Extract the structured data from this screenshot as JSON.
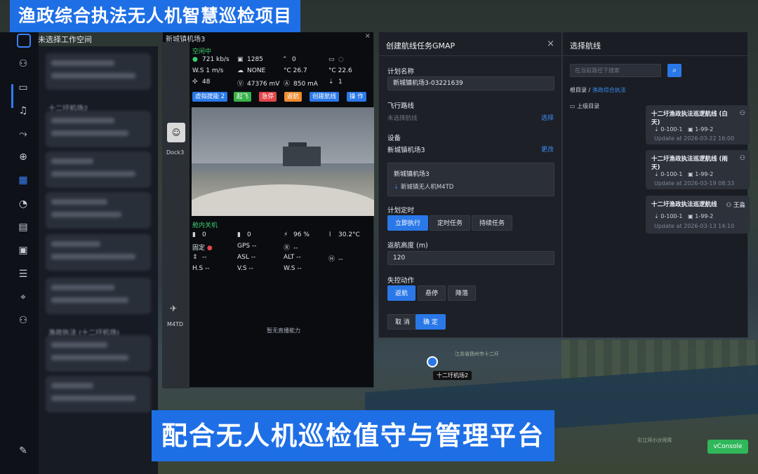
{
  "banner_top": "渔政综合执法无人机智慧巡检项目",
  "banner_bottom": "配合无人机巡检值守与管理平台",
  "workspace": "未选择工作空间",
  "device_list": {
    "labels": [
      "十二圩机场2",
      "渔政执法 (十二圩机场)"
    ]
  },
  "dock": {
    "title": "新城镇机场3",
    "close": "×",
    "dock_label": "Dock3",
    "drone_label": "M4TD",
    "status": "空闲中",
    "stats": {
      "net": "721 kb/s",
      "count": "1285",
      "wind_zero": "0",
      "ws": "W.S  1 m/s",
      "rain": "NONE",
      "temp1": "°C  26.7",
      "temp2": "°C  22.6",
      "n48": "48",
      "voltage": "47376 mV",
      "current": "850 mA",
      "one": "1"
    },
    "buttons": [
      "虚拟提能 2",
      "起飞",
      "急停",
      "返航",
      "创建航线",
      "操 作"
    ],
    "aircraft_status": "舱内关机",
    "aircraft": {
      "sig1": "0",
      "sig2": "0",
      "battery": "96 %",
      "temp": "30.2°C",
      "fix_label": "固定",
      "gps": "GPS  --",
      "r_val": "--",
      "v1": "--",
      "asl": "ASL  --",
      "alt": "ALT  --",
      "h_val": "--",
      "hs": "H.S  --",
      "vs": "V.S  --",
      "ws": "W.S  --"
    },
    "no_live": "暂无直播能力"
  },
  "plan": {
    "title": "创建航线任务GMAP",
    "close": "×",
    "name_label": "计划名称",
    "name_value": "新城镇机场3-03221639",
    "route_label": "飞行路线",
    "route_placeholder": "未选择航线",
    "route_link": "选择",
    "device_label": "设备",
    "device_value": "新城镇机场3",
    "device_link": "更改",
    "device_box_title": "新城镇机场3",
    "device_box_drone": "新城镇无人机M4TD",
    "timer_label": "计划定时",
    "timer_options": [
      "立即执行",
      "定时任务",
      "持续任务"
    ],
    "rth_label": "返航高度 (m)",
    "rth_value": "120",
    "lost_label": "失控动作",
    "lost_options": [
      "返航",
      "悬停",
      "降落"
    ],
    "cancel": "取 消",
    "confirm": "确 定"
  },
  "routes": {
    "title": "选择航线",
    "search_placeholder": "在当前路径下搜索",
    "crumb_root": "根目录",
    "crumb_sep": "/",
    "crumb_current": "渔政综合执法",
    "up_dir": "上级目录",
    "items": [
      {
        "name": "十二圩渔政执法巡逻航线 (白天)",
        "owner": "",
        "meta1": "0-100-1",
        "meta2": "1-99-2",
        "updated": "Update at 2026-03-22 16:00"
      },
      {
        "name": "十二圩渔政执法巡逻航线 (雨天)",
        "owner": "",
        "meta1": "0-100-1",
        "meta2": "1-99-2",
        "updated": "Update at 2026-03-19 08:33"
      },
      {
        "name": "十二圩渔政执法巡逻航线",
        "owner": "王淼",
        "meta1": "0-100-1",
        "meta2": "1-99-2",
        "updated": "Update at 2026-03-13 14:10"
      }
    ]
  },
  "map": {
    "tag": "十二圩机场2",
    "places": [
      "江苏省扬州市十二圩",
      "引江河小沙河湾"
    ]
  },
  "vconsole": "vConsole"
}
